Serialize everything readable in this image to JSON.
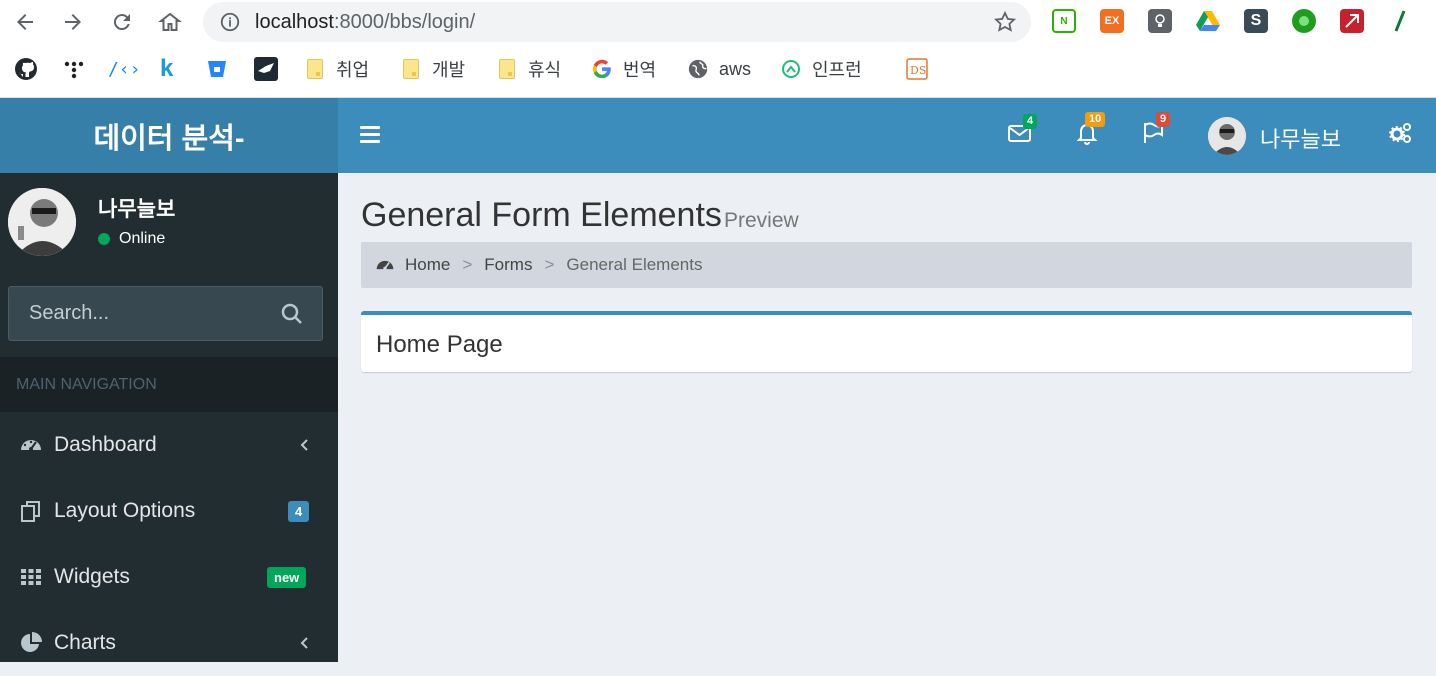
{
  "browser": {
    "url_host": "localhost",
    "url_path": ":8000/bbs/login/",
    "bookmarks": [
      "취업",
      "개발",
      "휴식",
      "번역",
      "aws",
      "인프런"
    ]
  },
  "header": {
    "logo": "데이터 분석-",
    "mail_count": "4",
    "notif_count": "10",
    "flag_count": "9",
    "user_name": "나무늘보"
  },
  "sidebar": {
    "user_name": "나무늘보",
    "status": "Online",
    "search_placeholder": "Search...",
    "nav_header": "MAIN NAVIGATION",
    "items": [
      {
        "label": "Dashboard"
      },
      {
        "label": "Layout Options",
        "badge": "4"
      },
      {
        "label": "Widgets",
        "badge": "new"
      },
      {
        "label": "Charts"
      }
    ]
  },
  "content": {
    "title": "General Form Elements",
    "subtitle": "Preview",
    "breadcrumb": [
      "Home",
      "Forms",
      "General Elements"
    ],
    "box_title": "Home Page"
  },
  "colors": {
    "primary": "#3c8dbc",
    "logo_bg": "#367fa9",
    "sidebar_bg": "#222d32",
    "success": "#00a65a",
    "warning": "#f39c12",
    "danger": "#dd4b39"
  }
}
